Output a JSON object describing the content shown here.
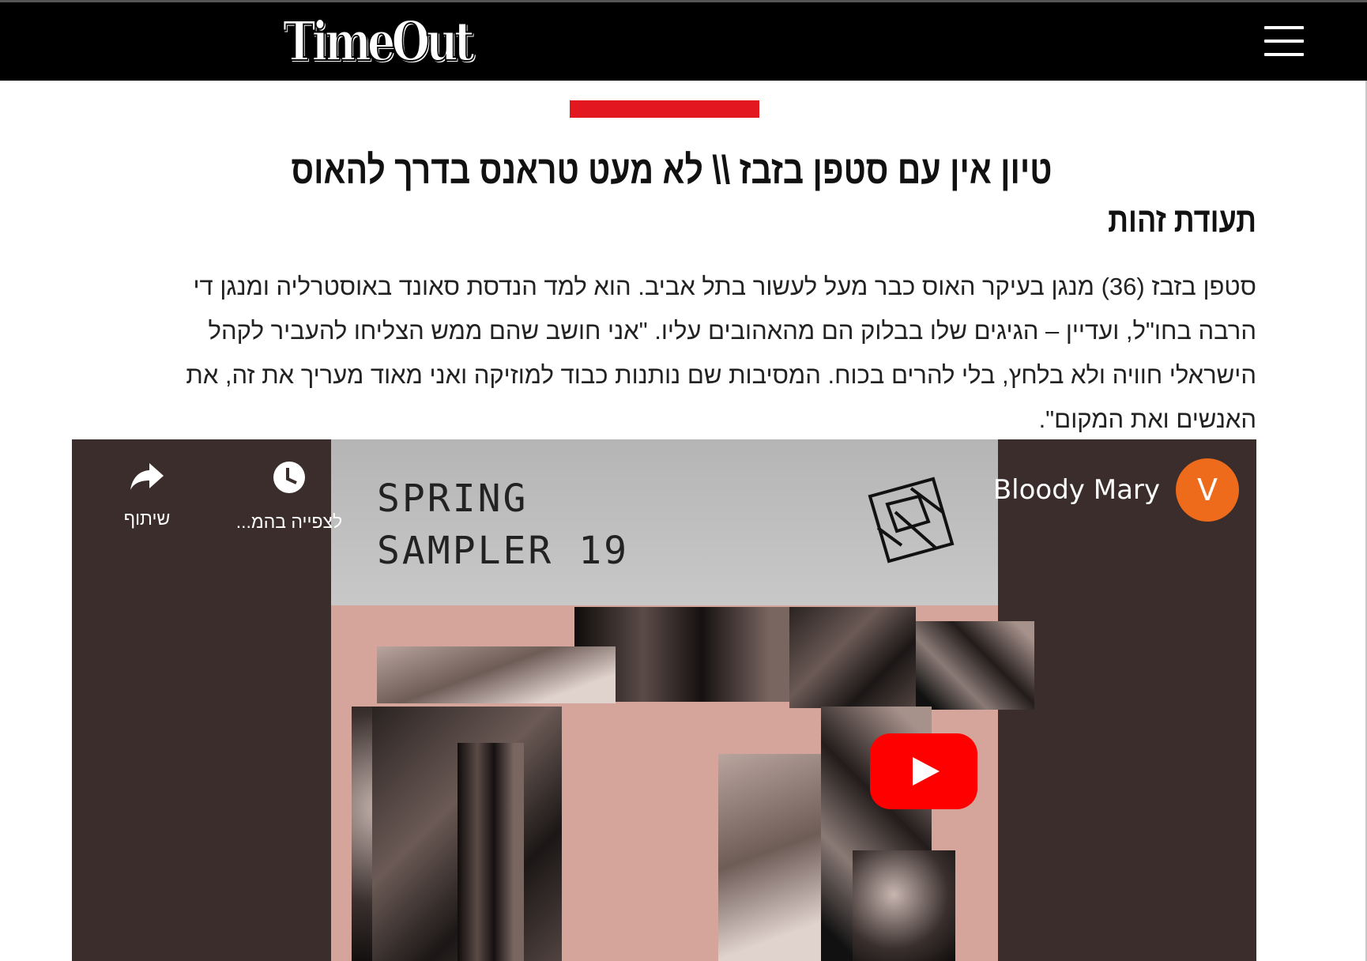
{
  "header": {
    "logo_text": "TimeOut",
    "menu_icon": "hamburger-menu-icon",
    "background": "#000000"
  },
  "accent_color": "#e3171f",
  "article": {
    "headline": "טיון אין עם סטפן בזבז \\\\ לא מעט טראנס בדרך להאוס",
    "section_heading": "תעודת זהות",
    "body_lines": [
      "סטפן בזבז (36) מנגן בעיקר האוס כבר מעל לעשור בתל אביב. הוא למד הנדסת סאונד באוסטרליה ומנגן די",
      "הרבה בחו\"ל, ועדיין – הגיגים שלו בבלוק הם מהאהובים עליו. \"אני חושב שהם ממש הצליחו להעביר לקהל",
      "הישראלי חוויה ולא בלחץ, בלי להרים בכוח. המסיבות שם נותנות כבוד למוזיקה ואני מאוד מעריך את זה, את",
      "האנשים ואת המקום\"."
    ]
  },
  "video": {
    "cover_title_line1": "SPRING",
    "cover_title_line2": "SAMPLER 19",
    "channel_name": "Bloody Mary",
    "avatar_letter": "V",
    "avatar_color": "#ef6b1c",
    "share_label": "שיתוף",
    "watch_later_label": "לצפייה בהמ...",
    "play_button_color": "#ff0000"
  }
}
